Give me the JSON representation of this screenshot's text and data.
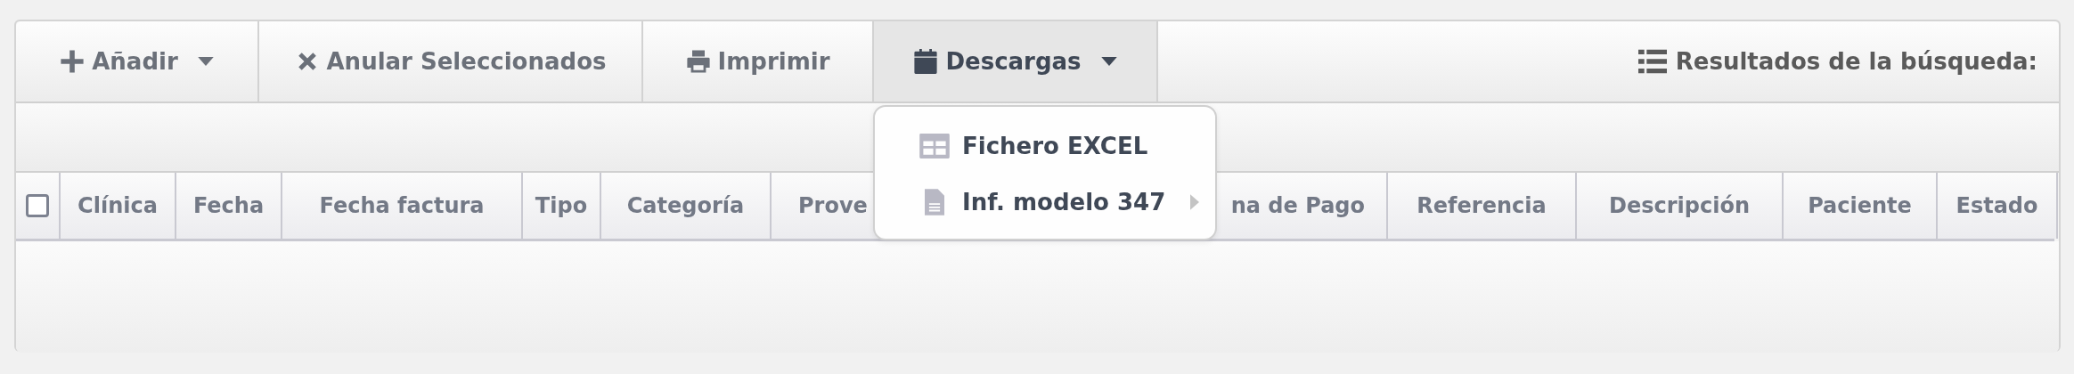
{
  "toolbar": {
    "buttons": [
      {
        "label": "Añadir",
        "kind": "add",
        "caret": true,
        "expanded": false
      },
      {
        "label": "Anular Seleccionados",
        "kind": "cancel",
        "caret": false,
        "expanded": false
      },
      {
        "label": "Imprimir",
        "kind": "print",
        "caret": false,
        "expanded": false
      },
      {
        "label": "Descargas",
        "kind": "calendar",
        "caret": true,
        "expanded": true
      }
    ],
    "results_label": "Resultados de la búsqueda:"
  },
  "dropdown": {
    "items": [
      {
        "label": "Fichero EXCEL",
        "kind": "table",
        "submenu": false
      },
      {
        "label": "Inf. modelo 347",
        "kind": "document",
        "submenu": true
      }
    ]
  },
  "table": {
    "select_all": {
      "checked": false
    },
    "columns": [
      {
        "label": "Clínica"
      },
      {
        "label": "Fecha"
      },
      {
        "label": "Fecha factura"
      },
      {
        "label": "Tipo"
      },
      {
        "label": "Categoría"
      },
      {
        "label": "Prove"
      },
      {
        "label": "na de Pago"
      },
      {
        "label": "Referencia"
      },
      {
        "label": "Descripción"
      },
      {
        "label": "Paciente"
      },
      {
        "label": "Estado"
      }
    ]
  }
}
